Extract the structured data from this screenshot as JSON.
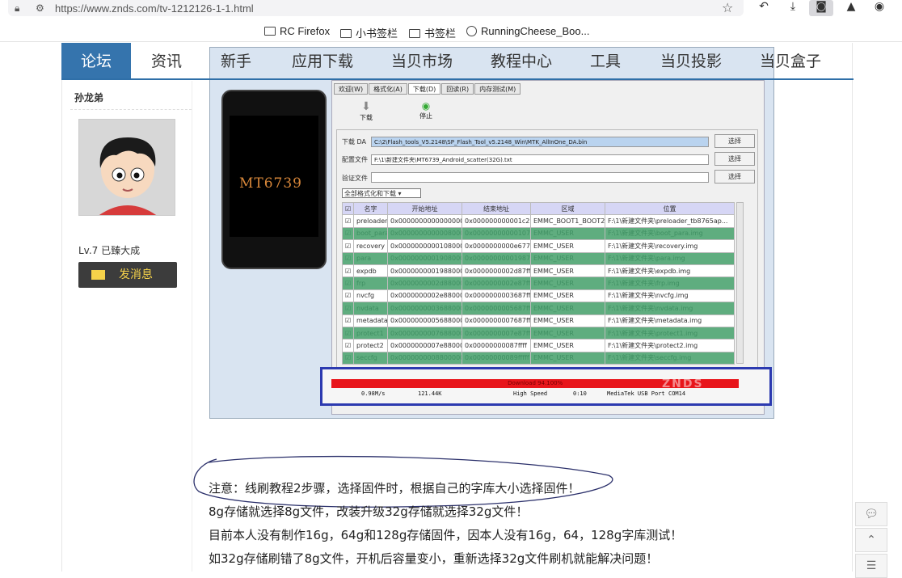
{
  "browser": {
    "url": "https://www.znds.com/tv-1212126-1-1.html",
    "bookmarks": [
      "RC Firefox",
      "小书签栏",
      "书签栏",
      "RunningCheese_Boo..."
    ]
  },
  "nav": {
    "items": [
      "论坛",
      "资讯",
      "新手",
      "应用下载",
      "当贝市场",
      "教程中心",
      "工具",
      "当贝投影",
      "当贝盒子"
    ]
  },
  "sidebar": {
    "username": "孙龙弟",
    "level": "Lv.7 已臻大成",
    "message_button": "发消息"
  },
  "screenshot": {
    "phone_label": "MT6739",
    "tabs": [
      "欢迎(W)",
      "格式化(A)",
      "下载(D)",
      "回读(R)",
      "内存测试(M)"
    ],
    "tools": [
      "下载",
      "停止"
    ],
    "download_da_label": "下载 DA",
    "download_da_path": "C:\\2\\Flash_tools_V5.2148\\SP_Flash_Tool_v5.2148_Win\\MTK_AllInOne_DA.bin",
    "scatter_label": "配置文件",
    "scatter_path": "F:\\1\\新建文件夹\\MT6739_Android_scatter(32G).txt",
    "auth_label": "验证文件",
    "select_label": "选择",
    "mode": "全部格式化和下载",
    "table_headers": [
      "名字",
      "开始地址",
      "结束地址",
      "区域",
      "位置"
    ],
    "table_rows": [
      [
        "preloader",
        "0x0000000000000000",
        "0x000000000001c22b",
        "EMMC_BOOT1_BOOT2",
        "F:\\1\\新建文件夹\\preloader_tb8765ap..."
      ],
      [
        "boot_para",
        "0x0000000000008000",
        "0x00000000000107fff",
        "EMMC_USER",
        "F:\\1\\新建文件夹\\boot_para.img"
      ],
      [
        "recovery",
        "0x0000000000108000",
        "0x0000000000e677ff",
        "EMMC_USER",
        "F:\\1\\新建文件夹\\recovery.img"
      ],
      [
        "para",
        "0x0000000001908000",
        "0x00000000001987fff",
        "EMMC_USER",
        "F:\\1\\新建文件夹\\para.img"
      ],
      [
        "expdb",
        "0x0000000001988000",
        "0x0000000002d87fff",
        "EMMC_USER",
        "F:\\1\\新建文件夹\\expdb.img"
      ],
      [
        "frp",
        "0x0000000002d88000",
        "0x0000000002e87fff",
        "EMMC_USER",
        "F:\\1\\新建文件夹\\frp.img"
      ],
      [
        "nvcfg",
        "0x0000000002e88000",
        "0x0000000003687fff",
        "EMMC_USER",
        "F:\\1\\新建文件夹\\nvcfg.img"
      ],
      [
        "nvdata",
        "0x0000000003688000",
        "0x0000000005687fff",
        "EMMC_USER",
        "F:\\1\\新建文件夹\\nvdata.img"
      ],
      [
        "metadata",
        "0x0000000005688000",
        "0x0000000007687fff",
        "EMMC_USER",
        "F:\\1\\新建文件夹\\metadata.img"
      ],
      [
        "protect1",
        "0x0000000007688000",
        "0x0000000007e87fff",
        "EMMC_USER",
        "F:\\1\\新建文件夹\\protect1.img"
      ],
      [
        "protect2",
        "0x0000000007e88000",
        "0x00000000087ffff",
        "EMMC_USER",
        "F:\\1\\新建文件夹\\protect2.img"
      ],
      [
        "seccfg",
        "0x0000000008800000",
        "0x00000000089fffff",
        "EMMC_USER",
        "F:\\1\\新建文件夹\\seccfg.img"
      ]
    ],
    "progress_text": "Download 94.100%",
    "progress": 0.941,
    "status": [
      "0.98M/s",
      "121.44K",
      "High Speed",
      "0:10",
      "MediaTek USB Port",
      "COM14"
    ],
    "watermark": "ZNDS"
  },
  "notes": [
    "注意：线刷教程2步骤，选择固件时，根据自己的字库大小选择固件！",
    "8g存储就选择8g文件，改装升级32g存储就选择32g文件！",
    "目前本人没有制作16g，64g和128g存储固件，因本人没有16g，64，128g字库测试！",
    "如32g存储刷错了8g文件，开机后容量变小，重新选择32g文件刷机就能解决问题！"
  ],
  "colors": {
    "nav_active": "#3574ad",
    "progress": "#e8151b",
    "highlight_box": "#2c3ab0",
    "row_green": "#5fad7f"
  }
}
